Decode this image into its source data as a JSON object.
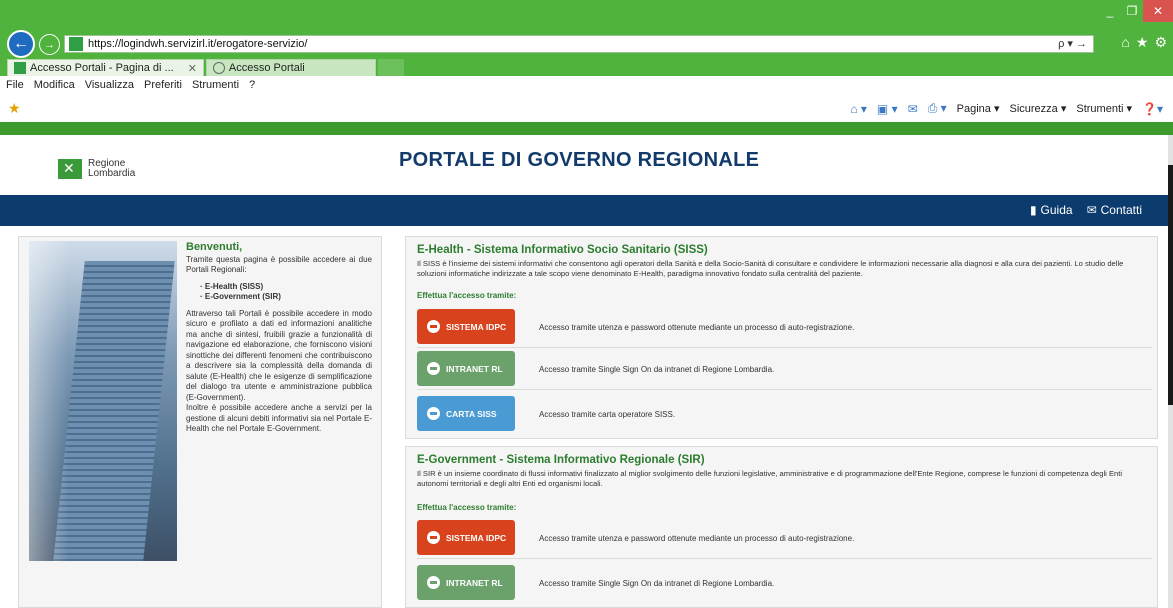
{
  "browser": {
    "url": "https://logindwh.servizirl.it/erogatore-servizio/",
    "search_glyph": "ρ ▾ →",
    "tabs": [
      {
        "label": "Accesso Portali - Pagina di ...",
        "close": "✕",
        "active": true
      },
      {
        "label": "Accesso Portali",
        "active": false
      }
    ],
    "menu": [
      "File",
      "Modifica",
      "Visualizza",
      "Preferiti",
      "Strumenti",
      "?"
    ],
    "commands": [
      "Pagina ▾",
      "Sicurezza ▾",
      "Strumenti ▾"
    ],
    "window_controls": [
      "_",
      "❐",
      "✕"
    ]
  },
  "header": {
    "logo_line1": "Regione",
    "logo_line2": "Lombardia",
    "title": "PORTALE DI GOVERNO REGIONALE"
  },
  "nav": {
    "guida": "Guida",
    "contatti": "Contatti"
  },
  "welcome": {
    "title": "Benvenuti,",
    "intro": "Tramite questa pagina è possibile accedere ai due Portali Regionali:",
    "items": [
      "E-Health (SISS)",
      "E-Government (SIR)"
    ],
    "body": "Attraverso tali Portali è possibile accedere in modo sicuro e profilato a dati ed informazioni analitiche ma anche di sintesi, fruibili grazie a funzionalità di navigazione ed elaborazione, che forniscono visioni sinottiche dei differenti fenomeni che contribuiscono a descrivere sia la complessità della domanda di salute (E-Health) che le esigenze di semplificazione del dialogo tra utente e amministrazione pubblica (E-Government).",
    "body2": "Inoltre è possibile accedere anche a servizi per la gestione di alcuni debiti informativi sia nel Portale E-Health che nel Portale E-Government."
  },
  "ehealth": {
    "title": "E-Health - Sistema Informativo Socio Sanitario (SISS)",
    "desc": "Il SISS è l'insieme dei sistemi informativi che consentono agli operatori della Sanità e della Socio-Sanità di consultare e condividere le informazioni necessarie alla diagnosi e alla cura dei pazienti. Lo studio delle soluzioni informatiche indirizzate a tale scopo viene denominato E-Health, paradigma innovativo fondato sulla centralità del paziente.",
    "via": "Effettua l'accesso tramite:",
    "rows": [
      {
        "button": "SISTEMA IDPC",
        "text": "Accesso tramite utenza e password ottenute mediante un processo di auto-registrazione."
      },
      {
        "button": "INTRANET RL",
        "text": "Accesso tramite Single Sign On da intranet di Regione Lombardia."
      },
      {
        "button": "CARTA SISS",
        "text": "Accesso tramite carta operatore SISS."
      }
    ]
  },
  "egov": {
    "title": "E-Government - Sistema Informativo Regionale (SIR)",
    "desc": "Il SIR è un insieme coordinato di flussi informativi finalizzato al miglior svolgimento delle funzioni legislative, amministrative e di programmazione dell'Ente Regione, comprese le funzioni di competenza degli Enti autonomi territoriali e degli altri Enti ed organismi locali.",
    "via": "Effettua l'accesso tramite:",
    "rows": [
      {
        "button": "SISTEMA IDPC",
        "text": "Accesso tramite utenza e password ottenute mediante un processo di auto-registrazione."
      },
      {
        "button": "INTRANET RL",
        "text": "Accesso tramite Single Sign On da intranet di Regione Lombardia."
      }
    ]
  }
}
